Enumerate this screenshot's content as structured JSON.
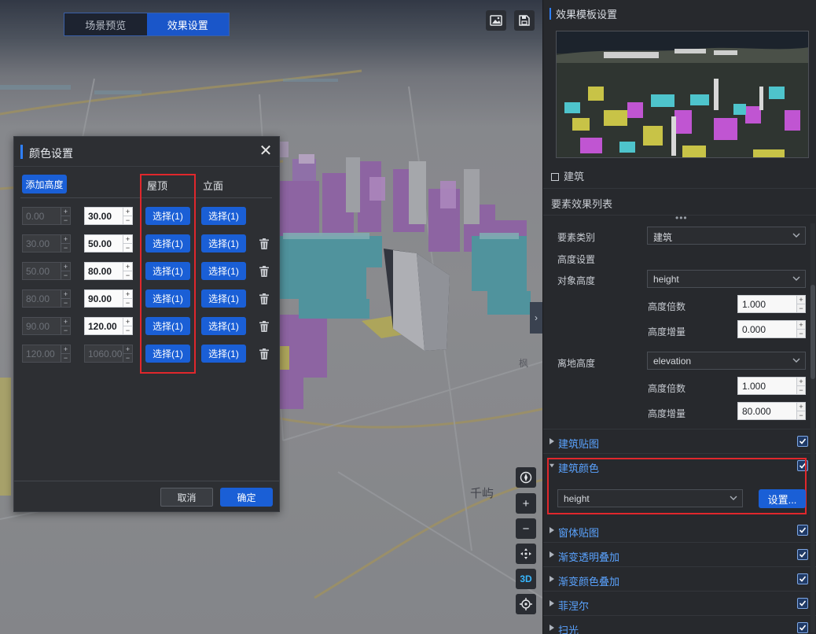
{
  "mode_toggle": {
    "preview_label": "场景预览",
    "settings_label": "效果设置"
  },
  "dialog": {
    "title": "颜色设置",
    "add_height_label": "添加高度",
    "roof_header": "屋顶",
    "facade_header": "立面",
    "rows": [
      {
        "min": "0.00",
        "max": "30.00",
        "roof": "选择(1)",
        "facade": "选择(1)"
      },
      {
        "min": "30.00",
        "max": "50.00",
        "roof": "选择(1)",
        "facade": "选择(1)"
      },
      {
        "min": "50.00",
        "max": "80.00",
        "roof": "选择(1)",
        "facade": "选择(1)"
      },
      {
        "min": "80.00",
        "max": "90.00",
        "roof": "选择(1)",
        "facade": "选择(1)"
      },
      {
        "min": "90.00",
        "max": "120.00",
        "roof": "选择(1)",
        "facade": "选择(1)"
      },
      {
        "min": "120.00",
        "max": "1060.00",
        "roof": "选择(1)",
        "facade": "选择(1)"
      }
    ],
    "cancel_label": "取消",
    "ok_label": "确定"
  },
  "map_tools": {
    "three_d_label": "3D"
  },
  "panel": {
    "template_title": "效果模板设置",
    "building_label": "建筑",
    "feature_list_title": "要素效果列表",
    "feature_type_label": "要素类别",
    "feature_type_value": "建筑",
    "height_settings_label": "高度设置",
    "object_height_label": "对象高度",
    "object_height_value": "height",
    "height_multiplier_label": "高度倍数",
    "height_multiplier_value": "1.000",
    "height_increment_label": "高度增量",
    "height_increment_value": "0.000",
    "ground_height_label": "离地高度",
    "ground_height_value": "elevation",
    "ground_multiplier_label": "高度倍数",
    "ground_multiplier_value": "1.000",
    "ground_increment_label": "高度增量",
    "ground_increment_value": "80.000",
    "layers": [
      "建筑贴图",
      "建筑颜色",
      "窗体贴图",
      "渐变透明叠加",
      "渐变颜色叠加",
      "菲涅尔",
      "扫光"
    ],
    "color_field_value": "height",
    "settings_button": "设置..."
  },
  "colors": {
    "accent": "#1a5fd6",
    "highlight_box": "#e0272c",
    "link_blue": "#5aa3ff"
  }
}
